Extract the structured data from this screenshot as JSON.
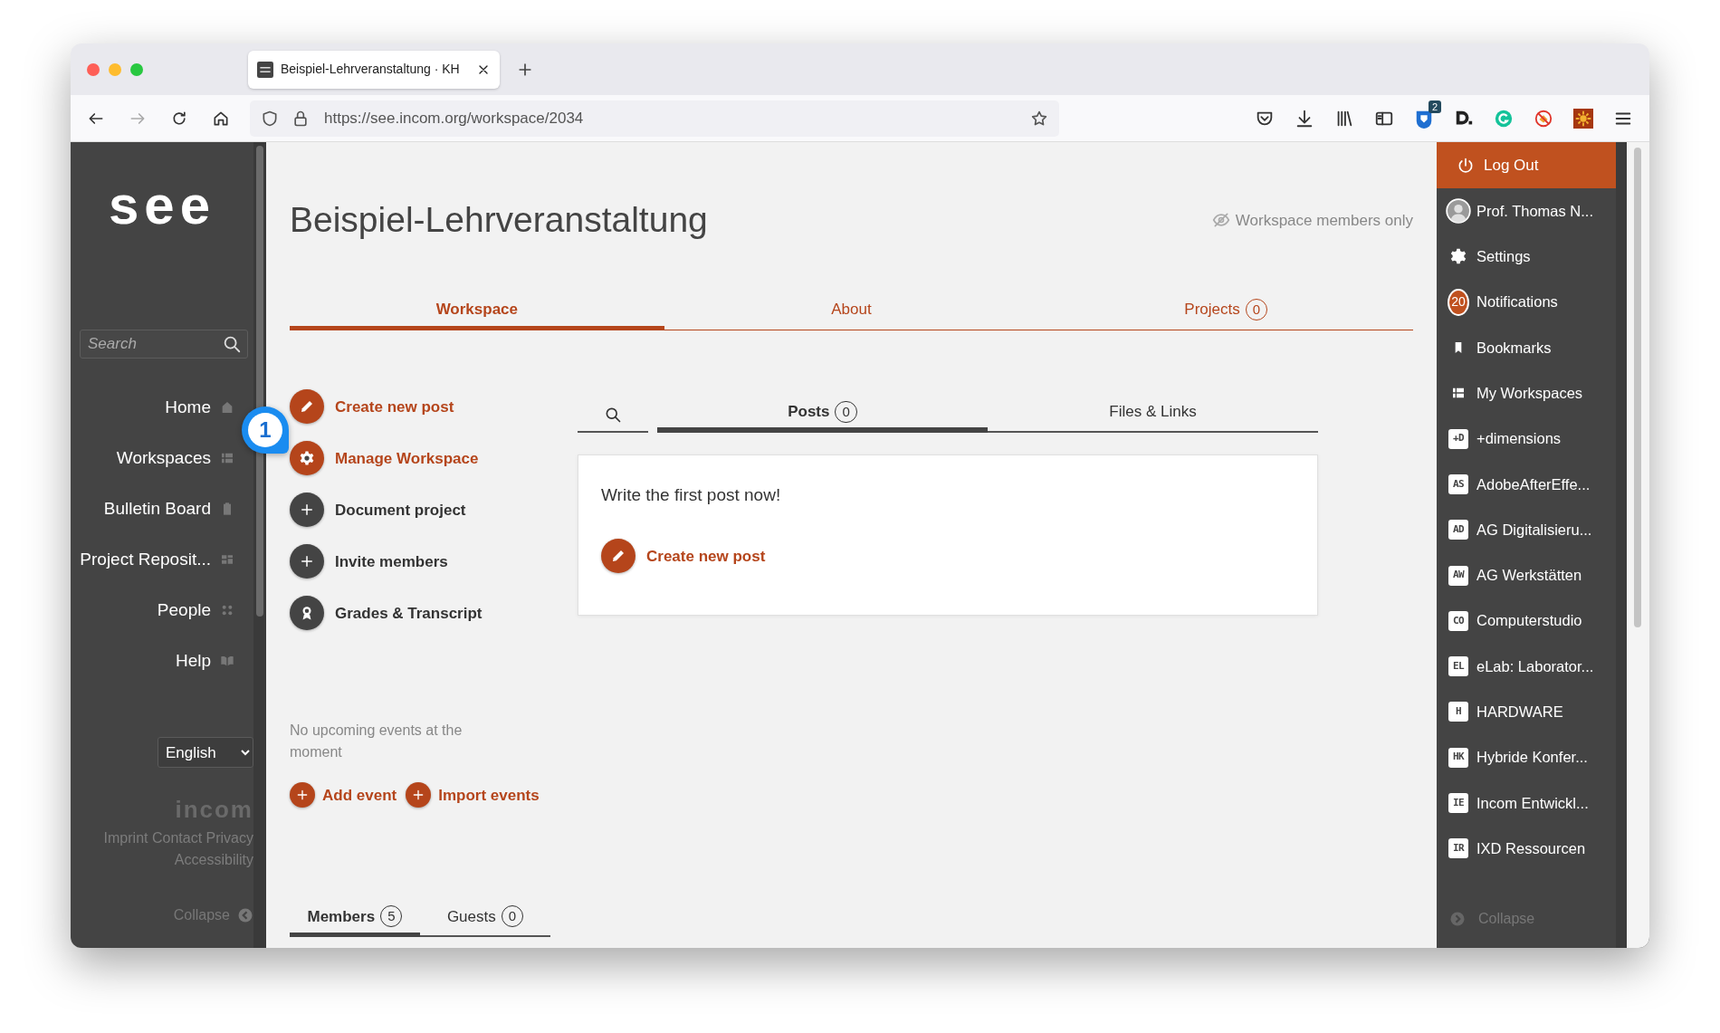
{
  "browser": {
    "tab_title": "Beispiel-Lehrveranstaltung · KH",
    "url": "https://see.incom.org/workspace/2034",
    "extension_badge": "2"
  },
  "left_nav": {
    "logo": "see",
    "search": {
      "placeholder": "Search"
    },
    "items": [
      {
        "label": "Home",
        "kind": "home"
      },
      {
        "label": "Workspaces",
        "kind": "list"
      },
      {
        "label": "Bulletin Board",
        "kind": "clipboard"
      },
      {
        "label": "Project Reposit...",
        "kind": "grid"
      },
      {
        "label": "People",
        "kind": "dots"
      },
      {
        "label": "Help",
        "kind": "book"
      }
    ],
    "language": "English",
    "brand": "incom",
    "footer_links": [
      "Imprint",
      "Contact",
      "Privacy",
      "Accessibility"
    ],
    "collapse": "Collapse"
  },
  "callout": "1",
  "workspace": {
    "title": "Beispiel-Lehrveranstaltung",
    "visibility": "Workspace members only",
    "tabs": [
      {
        "label": "Workspace",
        "selected": true
      },
      {
        "label": "About",
        "selected": false
      },
      {
        "label": "Projects",
        "count": "0",
        "selected": false
      }
    ],
    "actions": [
      {
        "label": "Create new post",
        "kind": "edit",
        "accent": true
      },
      {
        "label": "Manage Workspace",
        "kind": "settings",
        "accent": true
      },
      {
        "label": "Document project",
        "kind": "add",
        "accent": false
      },
      {
        "label": "Invite members",
        "kind": "add",
        "accent": false
      },
      {
        "label": "Grades & Transcript",
        "kind": "award",
        "accent": false
      }
    ],
    "events": {
      "empty_text": "No upcoming events at the moment",
      "buttons": [
        "Add event",
        "Import events"
      ]
    },
    "member_tabs": [
      {
        "label": "Members",
        "count": "5",
        "selected": true
      },
      {
        "label": "Guests",
        "count": "0",
        "selected": false
      }
    ],
    "feed": {
      "tabs": [
        {
          "label": "Posts",
          "count": "0",
          "selected": true
        },
        {
          "label": "Files & Links",
          "selected": false
        }
      ],
      "empty_text": "Write the first post now!",
      "create": "Create new post"
    }
  },
  "right_nav": {
    "logout": "Log Out",
    "items": [
      {
        "kind": "avatar",
        "label": "Prof. Thomas N..."
      },
      {
        "kind": "settings",
        "label": "Settings"
      },
      {
        "kind": "notifications",
        "label": "Notifications",
        "count": "20"
      },
      {
        "kind": "bookmark",
        "label": "Bookmarks"
      },
      {
        "kind": "list",
        "label": "My Workspaces"
      },
      {
        "kind": "abbr",
        "abbr": "+D",
        "label": "+dimensions"
      },
      {
        "kind": "abbr",
        "abbr": "AS",
        "label": "AdobeAfterEffe..."
      },
      {
        "kind": "abbr",
        "abbr": "AD",
        "label": "AG Digitalisieru..."
      },
      {
        "kind": "abbr",
        "abbr": "AW",
        "label": "AG Werkstätten"
      },
      {
        "kind": "abbr",
        "abbr": "CO",
        "label": "Computerstudio"
      },
      {
        "kind": "abbr",
        "abbr": "EL",
        "label": "eLab: Laborator..."
      },
      {
        "kind": "abbr",
        "abbr": "H",
        "label": "HARDWARE"
      },
      {
        "kind": "abbr",
        "abbr": "HK",
        "label": "Hybride Konfer..."
      },
      {
        "kind": "abbr",
        "abbr": "IE",
        "label": "Incom Entwickl..."
      },
      {
        "kind": "abbr",
        "abbr": "IR",
        "label": "IXD Ressourcen"
      }
    ],
    "collapse": "Collapse"
  }
}
